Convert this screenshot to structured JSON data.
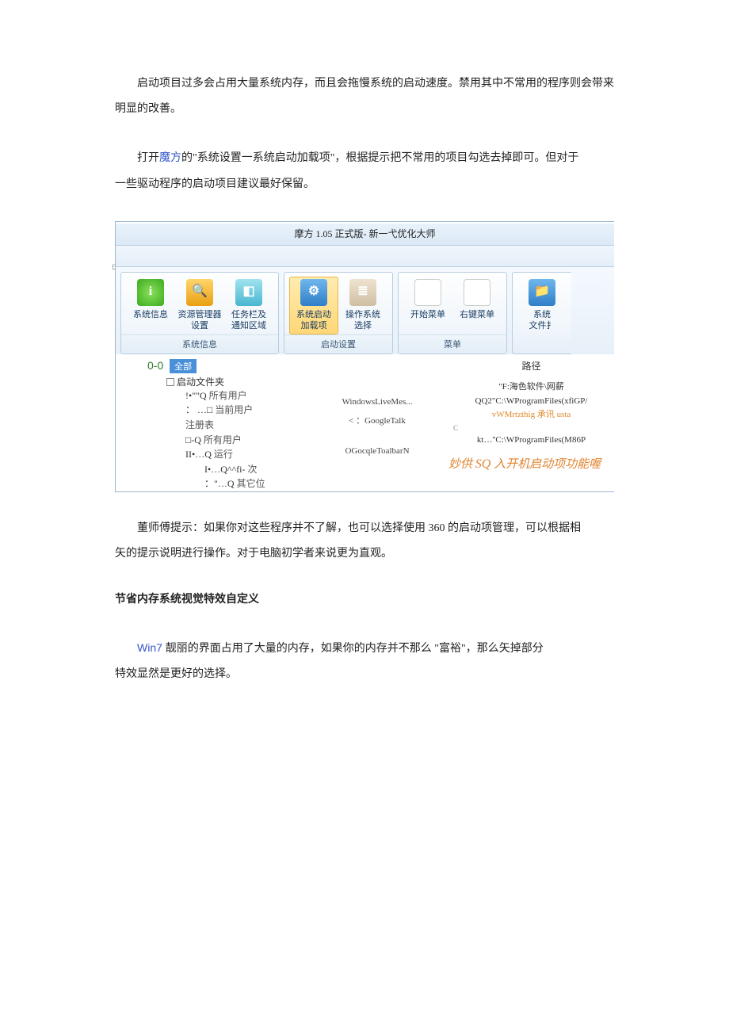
{
  "intro": {
    "p1": "启动项目过多会占用大量系统内存，而且会拖慢系统的启动速度。禁用其中不常用的程序则会带来明显的改善。",
    "p2_pre": "打开",
    "p2_link": "魔方",
    "p2_post": "的\"系统设置一系统启动加载项\"，根据提示把不常用的项目勾选去掉即可。但对于",
    "p2_cont": "一些驱动程序的启动项目建议最好保留。"
  },
  "app": {
    "title": "摩方 1.05 正式版- 新一弋优化大师",
    "nub": "£",
    "groups": [
      {
        "label": "系统信息",
        "tools": [
          {
            "name": "系统信息",
            "icon": "green",
            "glyph": "i"
          },
          {
            "name": "资源管理器\n设置",
            "icon": "orange",
            "glyph": "🔍"
          },
          {
            "name": "任务栏及\n通知区域",
            "icon": "aqua",
            "glyph": "◧"
          }
        ]
      },
      {
        "label": "启动设置",
        "tools": [
          {
            "name": "系统启动\n加载项",
            "icon": "blue",
            "glyph": "⚙",
            "active": true
          },
          {
            "name": "操作系统\n选择",
            "icon": "greige",
            "glyph": "≣"
          }
        ]
      },
      {
        "label": "菜单",
        "tools": [
          {
            "name": "开始菜单",
            "icon": "flag"
          },
          {
            "name": "右键菜单",
            "icon": "mix"
          }
        ]
      },
      {
        "label": "",
        "tools": [
          {
            "name": "系统\n文件扌",
            "icon": "blue",
            "glyph": "📁"
          }
        ],
        "cut": true
      }
    ],
    "tree": {
      "l0": "0-0",
      "pill": "全部",
      "l1": "启动文件夹",
      "rows": [
        {
          "sym": "!•\"\"Q",
          "txt": "所有用户"
        },
        {
          "sym": "：  …□",
          "txt": "当前用户"
        },
        {
          "sym": "",
          "txt": "注册表",
          "indent": 1
        },
        {
          "sym": "□-Q",
          "txt": "所有用户"
        },
        {
          "sym": "II•…Q",
          "txt": "运行"
        },
        {
          "sym": "I•…Q^^fi-",
          "txt": "次",
          "indent": 2
        },
        {
          "sym": "：\"…Q",
          "txt": "其它位",
          "indent": 2
        }
      ]
    },
    "col2": {
      "r1": "WindowsLiveMes...",
      "r2": "< ：GoogleTalk",
      "r3": "OGocqleToalbarN"
    },
    "col3": {
      "hdr": "路径",
      "p1": "\"F:海色软件\\网薪",
      "p2": "QQ2\"C:\\WProgramFiles(xfiGP/",
      "p3": "vWMrtzthig 承讯 usta",
      "small": "C",
      "p4": "kt…''C:\\WProgramFiles(M86P"
    },
    "foot_pre": "妙供 ",
    "foot_sq": "SQ",
    "foot_post": " 入开机启动项功能喔"
  },
  "tip": {
    "p1": "董师傅提示：如果你对这些程序并不了解，也可以选择使用 360 的启动项管理，可以根据相",
    "p1c": "矢的提示说明进行操作。对于电脑初学者来说更为直观。"
  },
  "section2": {
    "heading": "节省内存系统视觉特效自定义",
    "p1_pre": "Win7 ",
    "p1_post": "靓丽的界面占用了大量的内存，如果你的内存并不那么 \"富裕\"，那么矢掉部分",
    "p1c": "特效显然是更好的选择。"
  }
}
